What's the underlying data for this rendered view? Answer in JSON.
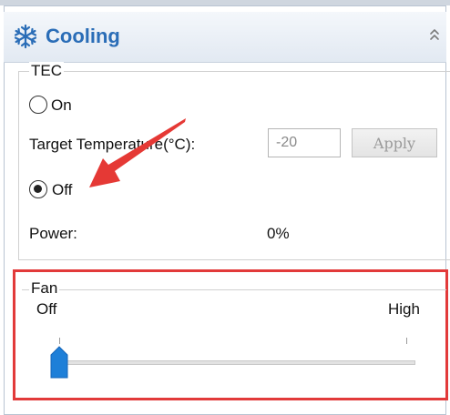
{
  "panel": {
    "title": "Cooling",
    "icon": "snowflake-icon",
    "accent_color": "#2a6db7"
  },
  "tec": {
    "group_label": "TEC",
    "on_label": "On",
    "on_checked": false,
    "target_temp_label": "Target Temperature(°C):",
    "target_temp_value": "-20",
    "apply_label": "Apply",
    "apply_enabled": false,
    "off_label": "Off",
    "off_checked": true,
    "power_label": "Power:",
    "power_value": "0%"
  },
  "fan": {
    "group_label": "Fan",
    "min_label": "Off",
    "max_label": "High",
    "slider_value": 0,
    "highlight_color": "#e23a3a"
  },
  "annotation": {
    "arrow_color": "#e53935"
  }
}
